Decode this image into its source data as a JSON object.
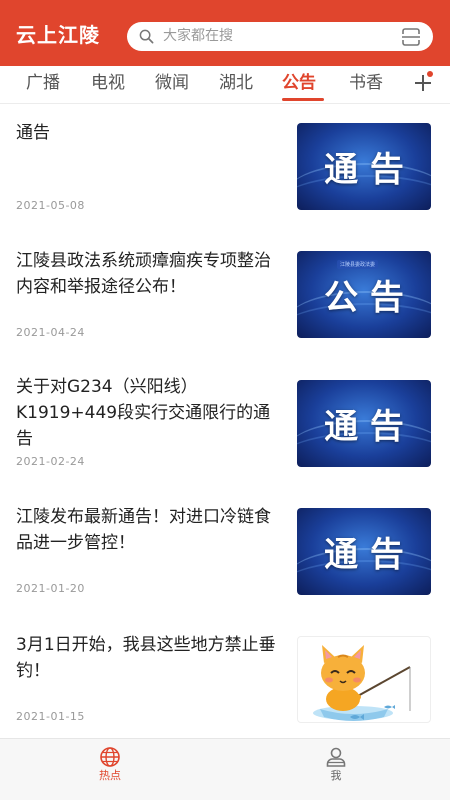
{
  "header": {
    "app_title": "云上江陵",
    "search_placeholder": "大家都在搜"
  },
  "tabs": [
    {
      "label": "广播"
    },
    {
      "label": "电视"
    },
    {
      "label": "微闻"
    },
    {
      "label": "湖北"
    },
    {
      "label": "公告",
      "active": true
    },
    {
      "label": "书香"
    }
  ],
  "articles": [
    {
      "title": "通告",
      "date": "2021-05-08",
      "thumb_text": "通 告"
    },
    {
      "title": "江陵县政法系统顽瘴痼疾专项整治内容和举报途径公布！",
      "date": "2021-04-24",
      "thumb_text": "公 告",
      "thumb_badge": "江陵县委政法委"
    },
    {
      "title": "关于对G234（兴阳线）K1919+449段实行交通限行的通告",
      "date": "2021-02-24",
      "thumb_text": "通 告"
    },
    {
      "title": "江陵发布最新通告！对进口冷链食品进一步管控！",
      "date": "2021-01-20",
      "thumb_text": "通 告"
    },
    {
      "title": "3月1日开始，我县这些地方禁止垂钓！",
      "date": "2021-01-15",
      "thumb_image": "cartoon-cat-fishing"
    }
  ],
  "bottom_nav": [
    {
      "label": "热点",
      "icon": "globe-icon",
      "active": true
    },
    {
      "label": "我",
      "icon": "user-icon",
      "active": false
    }
  ],
  "colors": {
    "brand": "#e0452d",
    "thumb_blue": "#1a3f9a"
  }
}
